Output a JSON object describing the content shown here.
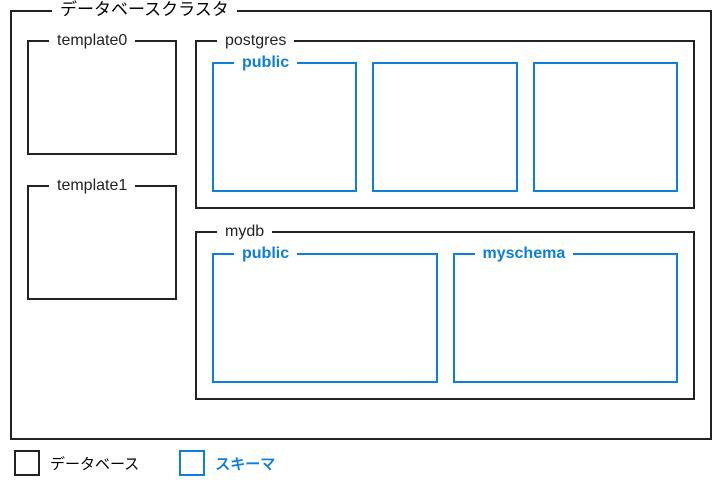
{
  "cluster": {
    "title": "データベースクラスタ",
    "templates": [
      "template0",
      "template1"
    ],
    "databases": [
      {
        "name": "postgres",
        "schemas": [
          "public",
          "",
          ""
        ]
      },
      {
        "name": "mydb",
        "schemas": [
          "public",
          "myschema"
        ]
      }
    ]
  },
  "legend": {
    "database": "データベース",
    "schema": "スキーマ"
  },
  "colors": {
    "database_border": "#222222",
    "schema_border": "#0d7edb"
  }
}
